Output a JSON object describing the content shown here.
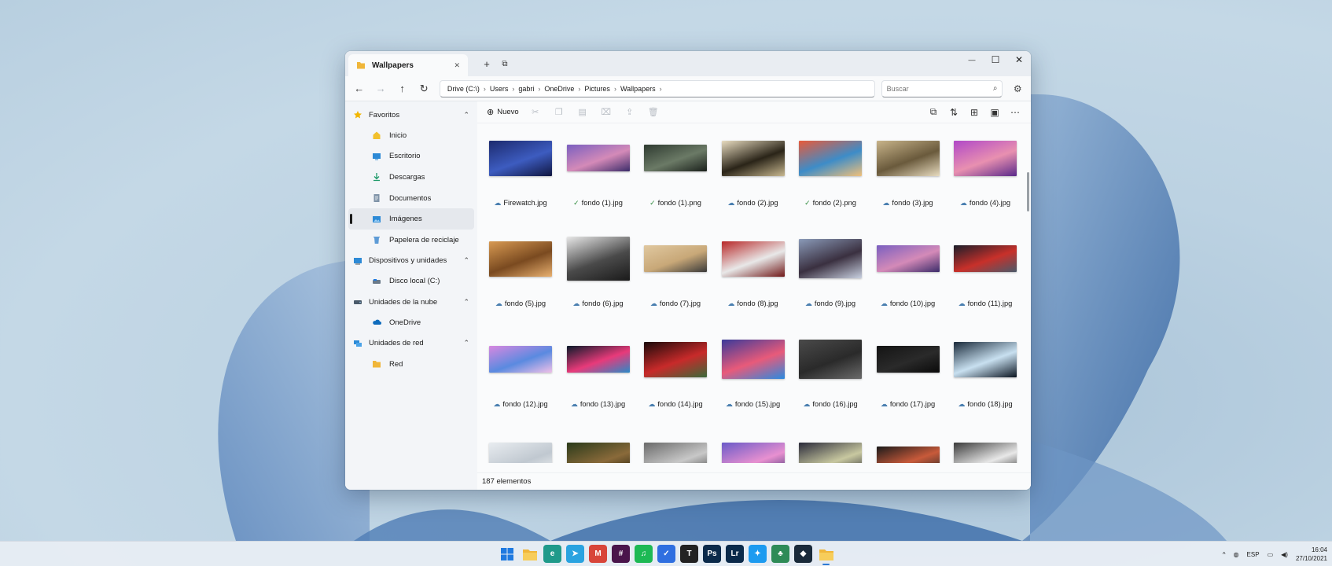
{
  "window": {
    "tab_title": "Wallpapers",
    "tab_close": "✕",
    "new_tab": "+",
    "controls": {
      "minimize": "—",
      "maximize": "☐",
      "close": "✕"
    }
  },
  "nav": {
    "breadcrumbs": [
      "Drive (C:\\)",
      "Users",
      "gabri",
      "OneDrive",
      "Pictures",
      "Wallpapers"
    ],
    "search_placeholder": "Buscar"
  },
  "sidebar": {
    "sections": [
      {
        "label": "Favoritos",
        "icon": "star-icon",
        "items": [
          {
            "label": "Inicio",
            "icon": "home-icon"
          },
          {
            "label": "Escritorio",
            "icon": "desktop-icon"
          },
          {
            "label": "Descargas",
            "icon": "download-icon"
          },
          {
            "label": "Documentos",
            "icon": "document-icon"
          },
          {
            "label": "Imágenes",
            "icon": "pictures-icon",
            "selected": true
          },
          {
            "label": "Papelera de reciclaje",
            "icon": "recycle-bin-icon"
          }
        ]
      },
      {
        "label": "Dispositivos y unidades",
        "icon": "devices-icon",
        "items": [
          {
            "label": "Disco local (C:)",
            "icon": "drive-icon"
          }
        ]
      },
      {
        "label": "Unidades de la nube",
        "icon": "cloud-drives-icon",
        "items": [
          {
            "label": "OneDrive",
            "icon": "onedrive-icon"
          }
        ]
      },
      {
        "label": "Unidades de red",
        "icon": "network-icon",
        "items": [
          {
            "label": "Red",
            "icon": "folder-icon"
          }
        ]
      }
    ]
  },
  "toolbar": {
    "new_label": "Nuevo"
  },
  "files": [
    {
      "name": "Firewatch.jpg",
      "status": "cloud",
      "colors": [
        "#1c2a6e",
        "#3d5cc0",
        "#101640"
      ],
      "ratio": 0.56
    },
    {
      "name": "fondo (1).jpg",
      "status": "synced",
      "colors": [
        "#7a5fc0",
        "#d48ab8",
        "#3b2c6a"
      ],
      "ratio": 0.42
    },
    {
      "name": "fondo (1).png",
      "status": "synced",
      "colors": [
        "#2e3a30",
        "#6b7a66",
        "#1a201b"
      ],
      "ratio": 0.42
    },
    {
      "name": "fondo (2).jpg",
      "status": "cloud",
      "colors": [
        "#e8dcc0",
        "#2a2418",
        "#c8b890"
      ],
      "ratio": 0.56
    },
    {
      "name": "fondo (2).png",
      "status": "synced",
      "colors": [
        "#e85a3a",
        "#3d8cc8",
        "#f0c07a"
      ],
      "ratio": 0.56
    },
    {
      "name": "fondo (3).jpg",
      "status": "cloud",
      "colors": [
        "#c8b48a",
        "#6a5a3c",
        "#e8dcc0"
      ],
      "ratio": 0.56
    },
    {
      "name": "fondo (4).jpg",
      "status": "cloud",
      "colors": [
        "#b048c8",
        "#e890b0",
        "#5a2a8a"
      ],
      "ratio": 0.56
    },
    {
      "name": "fondo (5).jpg",
      "status": "cloud",
      "colors": [
        "#d89a52",
        "#7a4a20",
        "#e8b070"
      ],
      "ratio": 0.56
    },
    {
      "name": "fondo (6).jpg",
      "status": "cloud",
      "colors": [
        "#e8e8e8",
        "#4a4a4a",
        "#1a1a1a"
      ],
      "ratio": 0.7
    },
    {
      "name": "fondo (7).jpg",
      "status": "cloud",
      "colors": [
        "#e0c8a0",
        "#c8a878",
        "#3a3a3a"
      ],
      "ratio": 0.42
    },
    {
      "name": "fondo (8).jpg",
      "status": "cloud",
      "colors": [
        "#b82828",
        "#e8e8e8",
        "#701818"
      ],
      "ratio": 0.56
    },
    {
      "name": "fondo (9).jpg",
      "status": "cloud",
      "colors": [
        "#8a9ab8",
        "#3a3040",
        "#c8d0e0"
      ],
      "ratio": 0.62
    },
    {
      "name": "fondo (10).jpg",
      "status": "cloud",
      "colors": [
        "#7a5fc0",
        "#d48ab8",
        "#3b2c6a"
      ],
      "ratio": 0.42
    },
    {
      "name": "fondo (11).jpg",
      "status": "cloud",
      "colors": [
        "#1a1e2a",
        "#c8302a",
        "#4a5a6a"
      ],
      "ratio": 0.42
    },
    {
      "name": "fondo (12).jpg",
      "status": "cloud",
      "colors": [
        "#d888e0",
        "#5a8ae0",
        "#f0c0e8"
      ],
      "ratio": 0.42
    },
    {
      "name": "fondo (13).jpg",
      "status": "cloud",
      "colors": [
        "#0a1a2a",
        "#e83a7a",
        "#2a8ac8"
      ],
      "ratio": 0.42
    },
    {
      "name": "fondo (14).jpg",
      "status": "cloud",
      "colors": [
        "#1a0a0a",
        "#c82a2a",
        "#3a6a3a"
      ],
      "ratio": 0.56
    },
    {
      "name": "fondo (15).jpg",
      "status": "cloud",
      "colors": [
        "#3a3a9a",
        "#e85a7a",
        "#2a8ae0"
      ],
      "ratio": 0.62
    },
    {
      "name": "fondo (16).jpg",
      "status": "cloud",
      "colors": [
        "#4a4a4a",
        "#2a2a2a",
        "#6a6a6a"
      ],
      "ratio": 0.62
    },
    {
      "name": "fondo (17).jpg",
      "status": "cloud",
      "colors": [
        "#141414",
        "#2a2a2a",
        "#0a0a0a"
      ],
      "ratio": 0.42
    },
    {
      "name": "fondo (18).jpg",
      "status": "cloud",
      "colors": [
        "#1a2a3a",
        "#c8e0f0",
        "#0a1420"
      ],
      "ratio": 0.56
    },
    {
      "name": "",
      "status": "",
      "colors": [
        "#e8ecf0",
        "#c0c8d0",
        "#f8f8f8"
      ],
      "ratio": 0.56
    },
    {
      "name": "",
      "status": "",
      "colors": [
        "#2a3a1a",
        "#8a6a3a",
        "#1a1a0a"
      ],
      "ratio": 0.56
    },
    {
      "name": "",
      "status": "",
      "colors": [
        "#6a6a6a",
        "#c8c8c8",
        "#3a3a3a"
      ],
      "ratio": 0.56
    },
    {
      "name": "",
      "status": "",
      "colors": [
        "#6a5ac8",
        "#e890d0",
        "#2a2a6a"
      ],
      "ratio": 0.56
    },
    {
      "name": "",
      "status": "",
      "colors": [
        "#2a2a3a",
        "#c8c8a0",
        "#1a1a2a"
      ],
      "ratio": 0.56
    },
    {
      "name": "",
      "status": "",
      "colors": [
        "#1a1a1a",
        "#c85a3a",
        "#2a2a2a"
      ],
      "ratio": 0.42
    },
    {
      "name": "",
      "status": "",
      "colors": [
        "#3a3a3a",
        "#e8e8e8",
        "#1a1a1a"
      ],
      "ratio": 0.56
    }
  ],
  "status": {
    "count_label": "187 elementos"
  },
  "taskbar": {
    "apps": [
      {
        "name": "start-icon",
        "label": "",
        "bg": "#1f7ae0"
      },
      {
        "name": "file-explorer-icon",
        "label": "",
        "bg": "#f0b63a"
      },
      {
        "name": "edge-icon",
        "label": "e",
        "bg": "#1f9a8a"
      },
      {
        "name": "telegram-icon",
        "label": "➤",
        "bg": "#2aa3e0"
      },
      {
        "name": "gmail-icon",
        "label": "M",
        "bg": "#d8453a"
      },
      {
        "name": "slack-icon",
        "label": "#",
        "bg": "#4a154b"
      },
      {
        "name": "spotify-icon",
        "label": "♫",
        "bg": "#1db954"
      },
      {
        "name": "todo-icon",
        "label": "✓",
        "bg": "#2f6fe0"
      },
      {
        "name": "typora-icon",
        "label": "T",
        "bg": "#222222"
      },
      {
        "name": "photoshop-icon",
        "label": "Ps",
        "bg": "#0b2a4a"
      },
      {
        "name": "lightroom-icon",
        "label": "Lr",
        "bg": "#0b2a4a"
      },
      {
        "name": "twitter-icon",
        "label": "✦",
        "bg": "#1d9bf0"
      },
      {
        "name": "plant-app-icon",
        "label": "♣",
        "bg": "#2e8b57"
      },
      {
        "name": "cube-app-icon",
        "label": "◆",
        "bg": "#1a2a3a"
      },
      {
        "name": "files-app-icon",
        "label": "",
        "bg": "#f0b63a",
        "active": true
      }
    ],
    "tray": {
      "chevron": "^",
      "lang": "ESP",
      "time": "16:04",
      "date": "27/10/2021"
    }
  }
}
